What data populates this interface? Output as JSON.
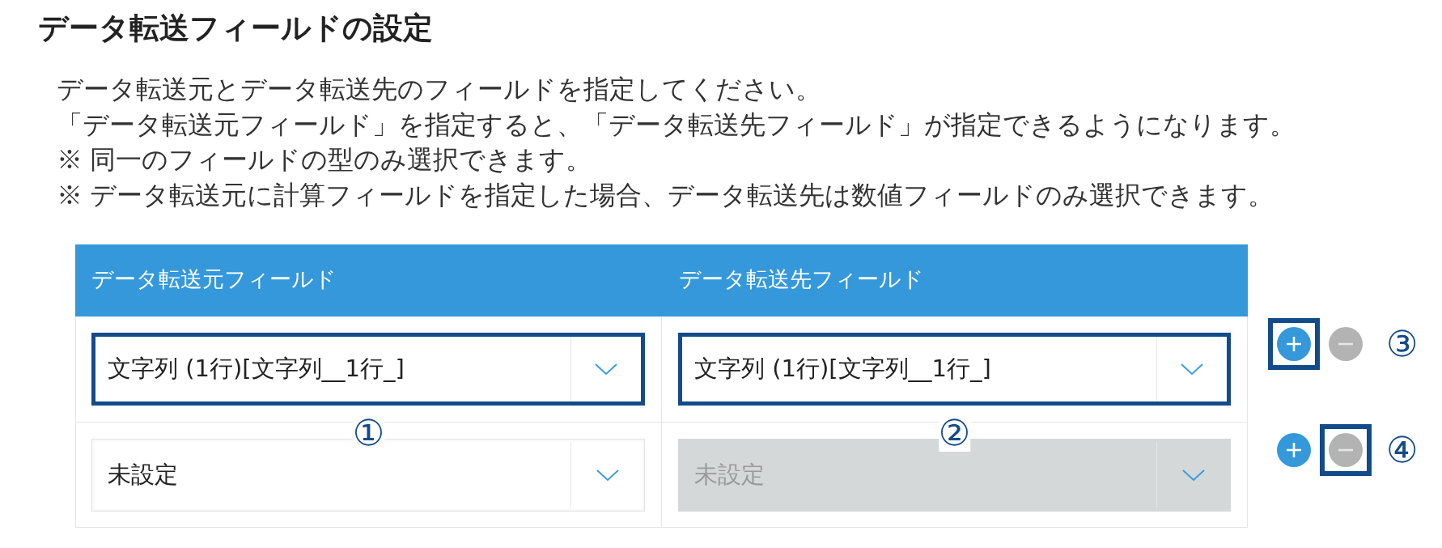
{
  "heading": "データ転送フィールドの設定",
  "instructions": [
    "データ転送元とデータ転送先のフィールドを指定してください。",
    "「データ転送元フィールド」を指定すると、「データ転送先フィールド」が指定できるようになります。",
    "※ 同一のフィールドの型のみ選択できます。",
    "※ データ転送元に計算フィールドを指定した場合、データ転送先は数値フィールドのみ選択できます。"
  ],
  "table": {
    "columns": [
      "データ転送元フィールド",
      "データ転送先フィールド"
    ],
    "rows": [
      {
        "cells": [
          {
            "value": "文字列 (1行)[文字列__1行_]",
            "disabled": false,
            "highlighted": true,
            "callout": "①"
          },
          {
            "value": "文字列 (1行)[文字列__1行_]",
            "disabled": false,
            "highlighted": true,
            "callout": "②"
          }
        ],
        "actions": [
          {
            "kind": "add",
            "highlighted": true
          },
          {
            "kind": "remove",
            "highlighted": false
          }
        ],
        "callout": "③"
      },
      {
        "cells": [
          {
            "value": "未設定",
            "disabled": false,
            "highlighted": false
          },
          {
            "value": "未設定",
            "disabled": true,
            "highlighted": false
          }
        ],
        "actions": [
          {
            "kind": "add",
            "highlighted": false
          },
          {
            "kind": "remove",
            "highlighted": true
          }
        ],
        "callout": "④"
      }
    ]
  }
}
